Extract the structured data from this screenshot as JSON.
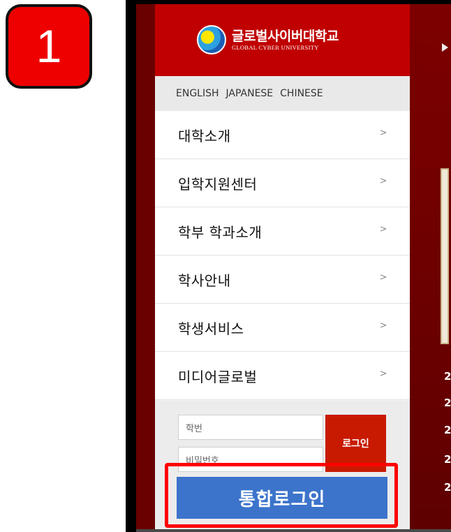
{
  "step_number": "1",
  "university": {
    "name_ko": "글로벌사이버대학교",
    "name_en": "GLOBAL CYBER UNIVERSITY"
  },
  "languages": [
    "ENGLISH",
    "JAPANESE",
    "CHINESE"
  ],
  "menu": [
    {
      "label": "대학소개",
      "chevron": ">"
    },
    {
      "label": "입학지원센터",
      "chevron": ">"
    },
    {
      "label": "학부 학과소개",
      "chevron": ">"
    },
    {
      "label": "학사안내",
      "chevron": ">"
    },
    {
      "label": "학생서비스",
      "chevron": ">"
    },
    {
      "label": "미디어글로벌",
      "chevron": ">"
    }
  ],
  "login": {
    "student_id_placeholder": "학번",
    "password_placeholder": "비밀번호",
    "login_label": "로그인",
    "sso_label": "통합로그인"
  },
  "background_list": [
    "2",
    "2",
    "2",
    "2",
    "2"
  ],
  "colors": {
    "header_red": "#c00000",
    "sso_blue": "#3c74cc",
    "highlight_red": "#ff0000"
  }
}
